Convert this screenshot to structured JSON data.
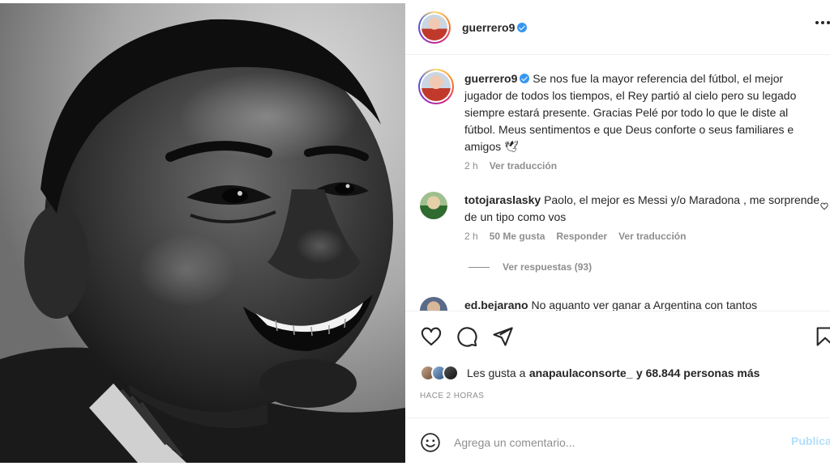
{
  "post": {
    "author": "guerrero9",
    "verified": true,
    "image_alt": "Black and white portrait of Pelé smiling"
  },
  "header": {
    "username": "guerrero9",
    "more_icon": "more-horizontal-icon"
  },
  "caption": {
    "username": "guerrero9",
    "text": "Se nos fue la mayor referencia del fútbol, el mejor jugador de todos los tiempos, el Rey partió al cielo pero su legado siempre estará presente. Gracias Pelé por todo lo que le diste al fútbol. Meus sentimentos e que Deus conforte o seus familiares e amigos 🕊",
    "time": "2 h",
    "translate": "Ver traducción"
  },
  "comments": [
    {
      "username": "totojaraslasky",
      "text": "Paolo, el mejor es Messi y/o Maradona , me sorprende de un tipo como vos",
      "time": "2 h",
      "likes": "50 Me gusta",
      "reply": "Responder",
      "translate": "Ver traducción",
      "view_replies": "Ver respuestas (93)"
    },
    {
      "username": "ed.bejarano",
      "text": "No aguanto ver ganar a Argentina con tantos"
    }
  ],
  "actions": {
    "like_icon": "heart-icon",
    "comment_icon": "comment-icon",
    "share_icon": "share-icon",
    "save_icon": "bookmark-icon"
  },
  "likes": {
    "prefix": "Les gusta a",
    "user": "anapaulaconsorte_",
    "suffix": "y 68.844 personas más"
  },
  "time_ago": "HACE 2 HORAS",
  "add_comment": {
    "placeholder": "Agrega un comentario...",
    "publish_label": "Publicar",
    "emoji_icon": "emoji-icon"
  },
  "colors": {
    "verified": "#3897f0",
    "publish_disabled": "#b2dffc",
    "muted_text": "#8e8e8e"
  }
}
